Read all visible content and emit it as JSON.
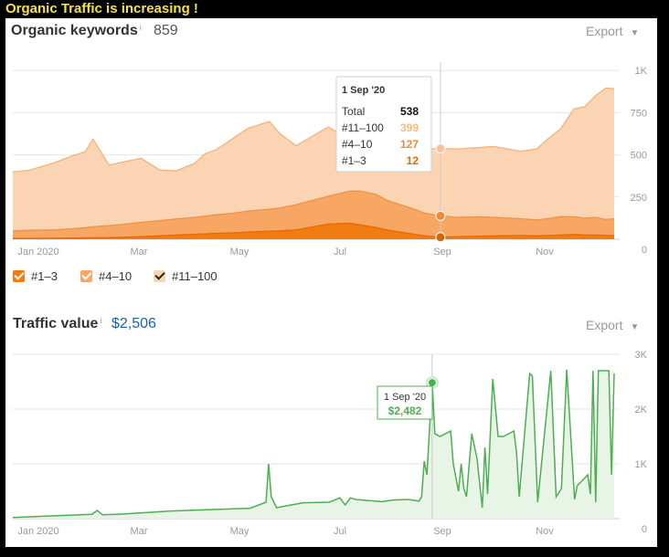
{
  "page": {
    "title": "Organic Traffic is increasing !"
  },
  "keywords": {
    "title": "Organic keywords",
    "info": "i",
    "value": "859",
    "export_label": "Export",
    "tooltip": {
      "date": "1 Sep '20",
      "rows": [
        {
          "label": "Total",
          "value": "538"
        },
        {
          "label": "#11–100",
          "value": "399"
        },
        {
          "label": "#4–10",
          "value": "127"
        },
        {
          "label": "#1–3",
          "value": "12"
        }
      ]
    },
    "legend": [
      {
        "label": "#1–3",
        "color": "#f27b12"
      },
      {
        "label": "#4–10",
        "color": "#f7a763"
      },
      {
        "label": "#11–100",
        "color": "#fbd5b3"
      }
    ]
  },
  "traffic": {
    "title": "Traffic value",
    "info": "i",
    "value": "$2,506",
    "export_label": "Export",
    "tooltip": {
      "date": "1 Sep '20",
      "value": "$2,482"
    }
  },
  "colors": {
    "top3": "#f27b12",
    "pos4_10": "#f7a763",
    "pos11_100": "#fbd5b3",
    "line_orange": "#f5b27a",
    "traffic": "#4caf50",
    "traffic_fill": "#e8f5e6",
    "value_blue": "#1a62a8"
  },
  "chart_data": [
    {
      "type": "area",
      "stacked": true,
      "x_tick_labels": [
        "Jan 2020",
        "Mar",
        "May",
        "Jul",
        "Sep",
        "Nov"
      ],
      "y_tick_labels": [
        "0",
        "250",
        "500",
        "750",
        "1K"
      ],
      "ylim": [
        0,
        1050
      ],
      "grid": true,
      "x": [
        0,
        0.3,
        0.8,
        1.1,
        1.35,
        1.5,
        1.8,
        2.4,
        2.75,
        3.05,
        3.4,
        3.6,
        3.8,
        4.1,
        4.4,
        4.8,
        5.0,
        5.3,
        5.9,
        6.3,
        6.5,
        6.8,
        7.0,
        7.5,
        7.7,
        8.0,
        8.3,
        8.7,
        9.0,
        9.5,
        9.8,
        10.0,
        10.25,
        10.5,
        10.7,
        10.9,
        11.1,
        11.25
      ],
      "series": [
        {
          "name": "#1–3",
          "values": [
            5,
            5,
            6,
            7,
            8,
            9,
            10,
            15,
            20,
            25,
            30,
            32,
            35,
            38,
            42,
            48,
            50,
            55,
            90,
            95,
            85,
            70,
            55,
            30,
            20,
            12,
            15,
            18,
            20,
            22,
            20,
            22,
            25,
            28,
            25,
            25,
            22,
            22
          ]
        },
        {
          "name": "#4–10",
          "values": [
            45,
            48,
            50,
            55,
            60,
            65,
            70,
            85,
            90,
            95,
            100,
            105,
            110,
            115,
            125,
            130,
            135,
            150,
            165,
            190,
            200,
            195,
            175,
            150,
            135,
            127,
            115,
            115,
            110,
            100,
            95,
            100,
            110,
            105,
            100,
            105,
            95,
            100
          ]
        },
        {
          "name": "#11–100",
          "values": [
            350,
            355,
            400,
            430,
            450,
            520,
            360,
            380,
            300,
            285,
            320,
            370,
            385,
            440,
            490,
            520,
            440,
            350,
            410,
            310,
            300,
            340,
            380,
            370,
            380,
            399,
            405,
            410,
            420,
            400,
            420,
            470,
            520,
            640,
            660,
            720,
            780,
            770
          ]
        }
      ]
    },
    {
      "type": "line",
      "x_tick_labels": [
        "Jan 2020",
        "Mar",
        "May",
        "Jul",
        "Sep",
        "Nov"
      ],
      "y_tick_labels": [
        "1K",
        "2K",
        "3K"
      ],
      "ylim": [
        0,
        3000
      ],
      "grid": true,
      "x": [
        0,
        1.0,
        1.5,
        1.6,
        1.7,
        2.0,
        3.0,
        4.5,
        4.8,
        4.85,
        4.9,
        5.0,
        5.5,
        6.0,
        6.2,
        6.3,
        6.4,
        6.5,
        7.0,
        7.2,
        7.5,
        7.7,
        7.75,
        7.8,
        7.85,
        7.95,
        8.0,
        8.1,
        8.3,
        8.35,
        8.45,
        8.5,
        8.55,
        8.6,
        8.7,
        8.8,
        8.9,
        8.95,
        9.0,
        9.1,
        9.2,
        9.3,
        9.5,
        9.55,
        9.6,
        9.8,
        9.85,
        9.95,
        10.2,
        10.3,
        10.4,
        10.5,
        10.65,
        10.7,
        10.9,
        10.95,
        11.0,
        11.05,
        11.1,
        11.2,
        11.3,
        11.35,
        11.4
      ],
      "series": [
        {
          "name": "",
          "values": [
            20,
            60,
            80,
            150,
            70,
            80,
            140,
            190,
            300,
            1000,
            400,
            200,
            290,
            300,
            380,
            250,
            380,
            350,
            310,
            340,
            350,
            320,
            400,
            1050,
            800,
            2482,
            1550,
            1500,
            1600,
            1000,
            500,
            1000,
            550,
            400,
            1550,
            1100,
            200,
            1300,
            450,
            2550,
            1500,
            1500,
            1600,
            1200,
            400,
            2650,
            2600,
            300,
            2700,
            400,
            550,
            2720,
            350,
            600,
            800,
            450,
            2700,
            300,
            2700,
            2700,
            2700,
            800,
            2650
          ]
        }
      ]
    }
  ]
}
